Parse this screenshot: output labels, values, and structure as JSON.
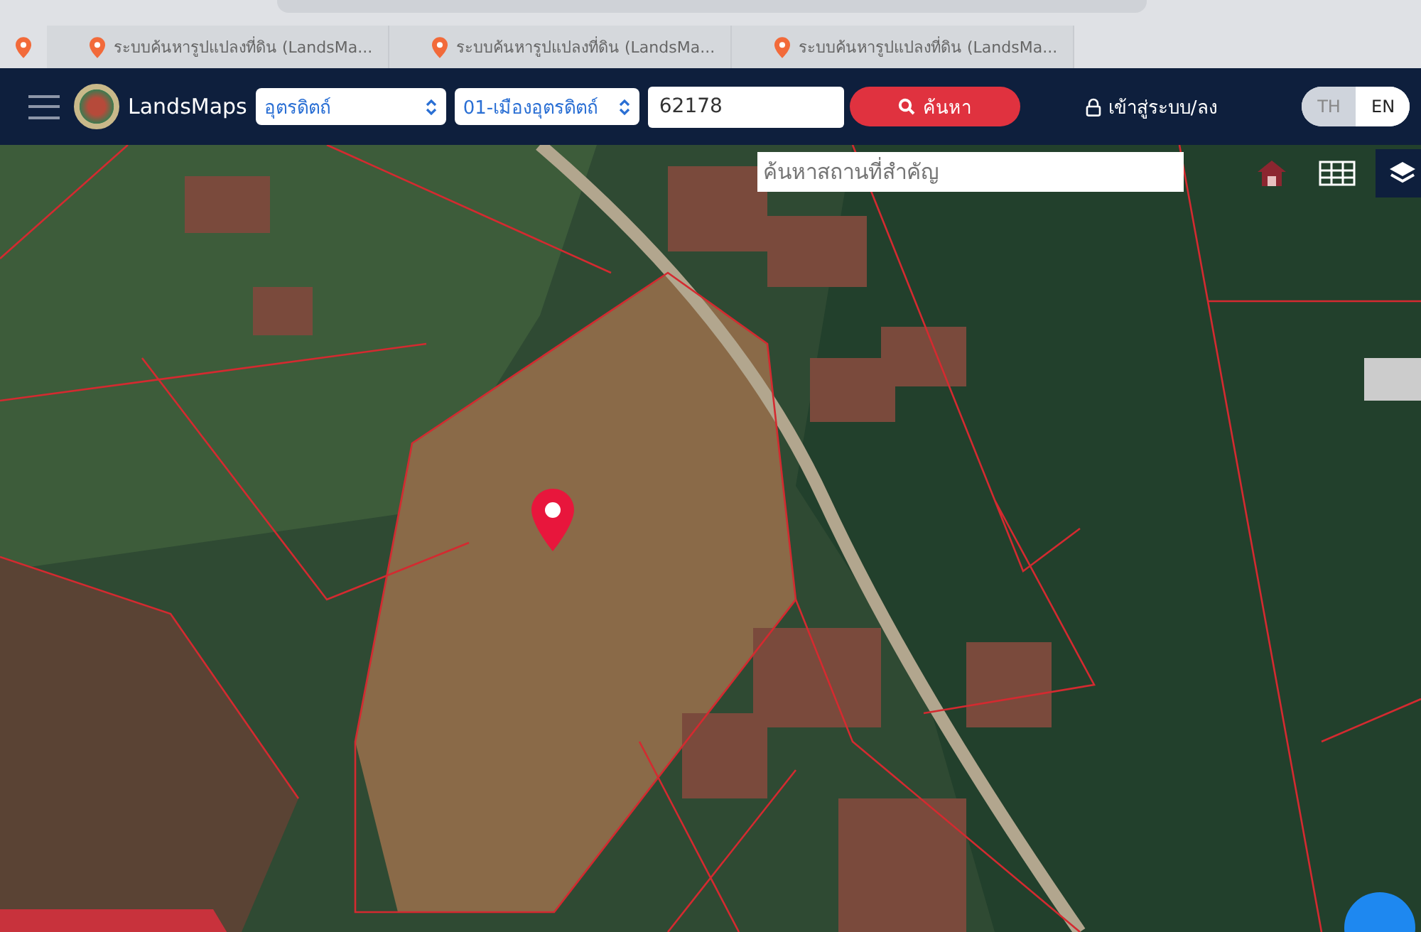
{
  "browser_tabs": [
    {
      "title": "ระบบค้นหารูปแปลงที่ดิน (LandsMa...",
      "selected": false
    },
    {
      "title": "ระบบค้นหารูปแปลงที่ดิน (LandsMa...",
      "selected": false
    },
    {
      "title": "ระบบค้นหารูปแปลงที่ดิน (LandsMa...",
      "selected": false
    }
  ],
  "navbar": {
    "brand": "LandsMaps",
    "province": "อุตรดิตถ์",
    "district": "01-เมืองอุตรดิตถ์",
    "parcel_number": "62178",
    "search_button": "ค้นหา",
    "login": "เข้าสู่ระบบ/ลง",
    "languages": [
      {
        "label": "TH",
        "selected": false
      },
      {
        "label": "EN",
        "selected": true
      }
    ]
  },
  "map": {
    "place_search": {
      "placeholder": "ค้นหาสถานที่สำคัญ"
    }
  }
}
